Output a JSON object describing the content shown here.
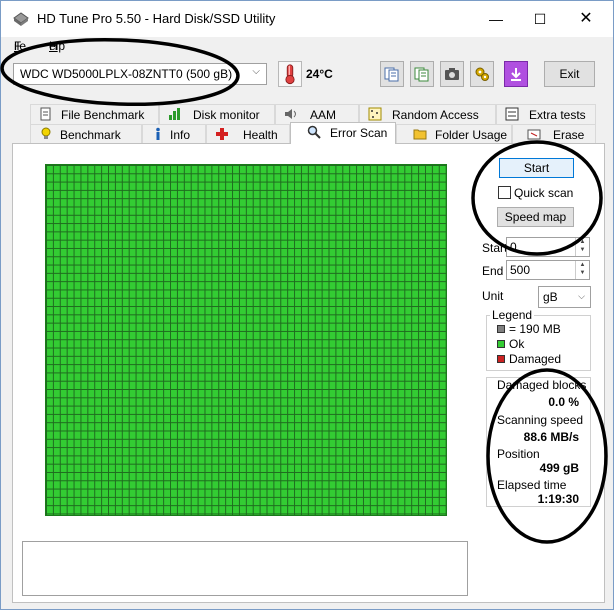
{
  "window": {
    "title": "HD Tune Pro 5.50 - Hard Disk/SSD Utility",
    "minimize_glyph": "—",
    "maximize_glyph": "☐",
    "close_glyph": "✕"
  },
  "menu": {
    "file_first": "F",
    "file_rest": "ile",
    "help_first": "H",
    "help_rest": "elp"
  },
  "toolbar": {
    "drive": "WDC WD5000LPLX-08ZNTT0 (500 gB)",
    "temperature": "24°C",
    "exit_label": "Exit",
    "icons": [
      "copy-info-icon",
      "copy-text-icon",
      "screenshot-icon",
      "options-icon",
      "download-icon"
    ]
  },
  "tabs": {
    "row1": [
      "File Benchmark",
      "Disk monitor",
      "AAM",
      "Random Access",
      "Extra tests"
    ],
    "row2": [
      "Benchmark",
      "Info",
      "Health",
      "Error Scan",
      "Folder Usage",
      "Erase"
    ],
    "active": "Error Scan"
  },
  "scan": {
    "start_label": "Start",
    "quick_scan_label": "Quick scan",
    "speed_map_label": "Speed map",
    "start_field_label": "Start",
    "start_value": "0",
    "end_field_label": "End",
    "end_value": "500",
    "unit_label": "Unit",
    "unit_value": "gB"
  },
  "legend": {
    "title": "Legend",
    "block_size": "= 190 MB",
    "ok": "Ok",
    "damaged": "Damaged",
    "colors": {
      "block": "#808080",
      "ok": "#33cc33",
      "damaged": "#cc2222"
    }
  },
  "stats": {
    "damaged_blocks_label": "Damaged blocks",
    "damaged_blocks_value": "0.0 %",
    "scanning_speed_label": "Scanning speed",
    "scanning_speed_value": "88.6 MB/s",
    "position_label": "Position",
    "position_value": "499 gB",
    "elapsed_label": "Elapsed time",
    "elapsed_value": "1:19:30"
  }
}
